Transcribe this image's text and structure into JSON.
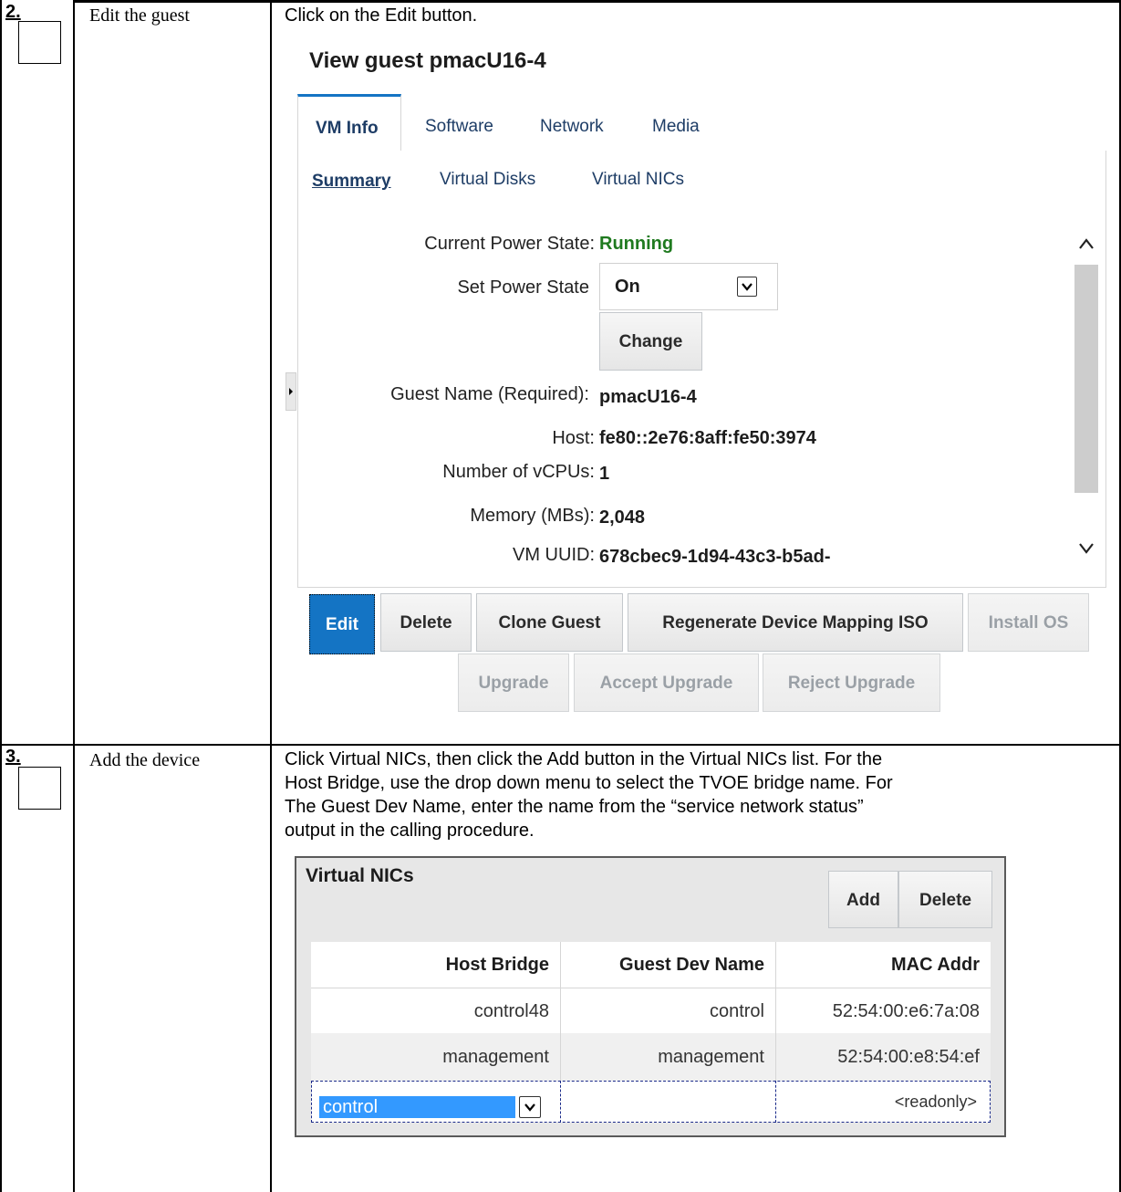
{
  "steps": [
    {
      "number": "2.",
      "title": "Edit the guest",
      "instruction": "Click on the Edit button."
    },
    {
      "number": "3.",
      "title": "Add the device",
      "instruction_lines": [
        "Click Virtual NICs, then click the Add button in the Virtual NICs list. For the",
        "Host Bridge, use the drop down menu to select the TVOE bridge name. For",
        "The Guest Dev Name, enter the name from the “service network status”",
        "output in the calling procedure."
      ]
    }
  ],
  "guest_view": {
    "title": "View guest pmacU16-4",
    "tabs": [
      "VM Info",
      "Software",
      "Network",
      "Media"
    ],
    "active_tab": "VM Info",
    "subtabs": [
      "Summary",
      "Virtual Disks",
      "Virtual NICs"
    ],
    "active_subtab": "Summary",
    "fields": {
      "current_power_state_label": "Current Power State:",
      "current_power_state_value": "Running",
      "set_power_state_label": "Set Power State",
      "set_power_state_value": "On",
      "change_button": "Change",
      "guest_name_label": "Guest Name (Required):",
      "guest_name_value": "pmacU16-4",
      "host_label": "Host:",
      "host_value": "fe80::2e76:8aff:fe50:3974",
      "vcpus_label": "Number of vCPUs:",
      "vcpus_value": "1",
      "memory_label": "Memory (MBs):",
      "memory_value": "2,048",
      "uuid_label": "VM UUID:",
      "uuid_value": "678cbec9-1d94-43c3-b5ad-"
    },
    "buttons": {
      "edit": "Edit",
      "delete": "Delete",
      "clone": "Clone Guest",
      "regenerate": "Regenerate Device Mapping ISO",
      "install_os": "Install OS",
      "upgrade": "Upgrade",
      "accept_upgrade": "Accept Upgrade",
      "reject_upgrade": "Reject Upgrade"
    },
    "colors": {
      "running": "#1f7a1f",
      "primary_button": "#1474c4"
    }
  },
  "virtual_nics": {
    "title": "Virtual NICs",
    "add_button": "Add",
    "delete_button": "Delete",
    "columns": [
      "Host Bridge",
      "Guest Dev Name",
      "MAC Addr"
    ],
    "rows": [
      [
        "control48",
        "control",
        "52:54:00:e6:7a:08"
      ],
      [
        "management",
        "management",
        "52:54:00:e8:54:ef"
      ]
    ],
    "new_row": {
      "host_bridge": "control",
      "mac": "<readonly>"
    }
  }
}
